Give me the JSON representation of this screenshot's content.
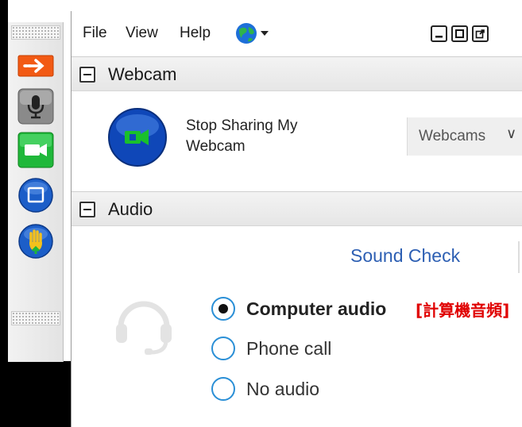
{
  "menubar": {
    "file_label": "File",
    "view_label": "View",
    "help_label": "Help"
  },
  "webcam_panel": {
    "title": "Webcam",
    "stop_sharing_label_line1": "Stop Sharing My",
    "stop_sharing_label_line2": "Webcam",
    "webcams_dropdown_value": "Webcams"
  },
  "audio_panel": {
    "title": "Audio",
    "sound_check_link": "Sound Check",
    "options": [
      {
        "label": "Computer audio",
        "selected": true
      },
      {
        "label": "Phone call",
        "selected": false
      },
      {
        "label": "No audio",
        "selected": false
      }
    ],
    "annotation": "[計算機音頻]"
  },
  "colors": {
    "link_blue": "#2d5fb3",
    "radio_blue": "#2a8fd6",
    "annotation_red": "#e00000",
    "webcam_button_blue": "#1656c8",
    "camera_green": "#19c02b"
  },
  "icons": {
    "toolbar": [
      "arrow-right-icon",
      "microphone-icon",
      "video-camera-icon",
      "screen-share-icon",
      "raise-hand-icon"
    ],
    "menubar": [
      "globe-icon",
      "dropdown-arrow-icon",
      "minimize-icon",
      "maximize-icon",
      "popout-icon"
    ],
    "audio": "headset-icon"
  }
}
